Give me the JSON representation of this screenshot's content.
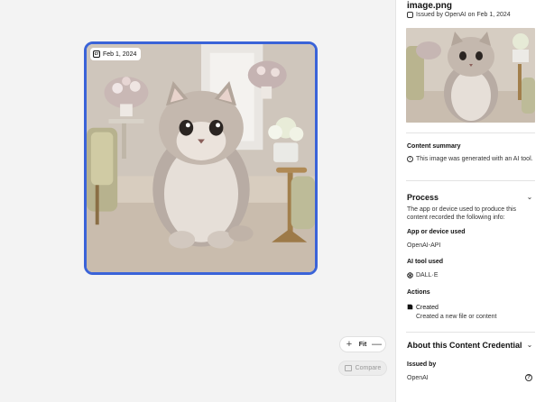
{
  "canvas": {
    "image_date_chip": "Feb 1, 2024",
    "zoom": {
      "plus": "+",
      "label": "Fit",
      "minus": "—"
    },
    "compare_label": "Compare"
  },
  "panel": {
    "file_name": "image.png",
    "issued_line": "Issued by OpenAI on Feb 1, 2024",
    "content_summary": {
      "title": "Content summary",
      "text": "This image was generated with an AI tool."
    },
    "process": {
      "title": "Process",
      "description": "The app or device used to produce this content recorded the following info:",
      "app_label": "App or device used",
      "app_value": "OpenAI-API",
      "ai_tool_label": "AI tool used",
      "ai_tool_value": "DALL·E",
      "actions_label": "Actions",
      "action_title": "Created",
      "action_desc": "Created a new file or content"
    },
    "about": {
      "title": "About this Content Credential",
      "issued_by_label": "Issued by",
      "issued_by_value": "OpenAI"
    }
  },
  "colors": {
    "accent": "#3a63d8",
    "panel_bg": "#ffffff",
    "canvas_bg": "#f3f3f3"
  },
  "icons": [
    "content-credential-icon",
    "info-icon",
    "chevron-down-icon",
    "openai-icon",
    "created-icon",
    "help-icon",
    "plus-icon",
    "minus-icon",
    "compare-icon"
  ]
}
